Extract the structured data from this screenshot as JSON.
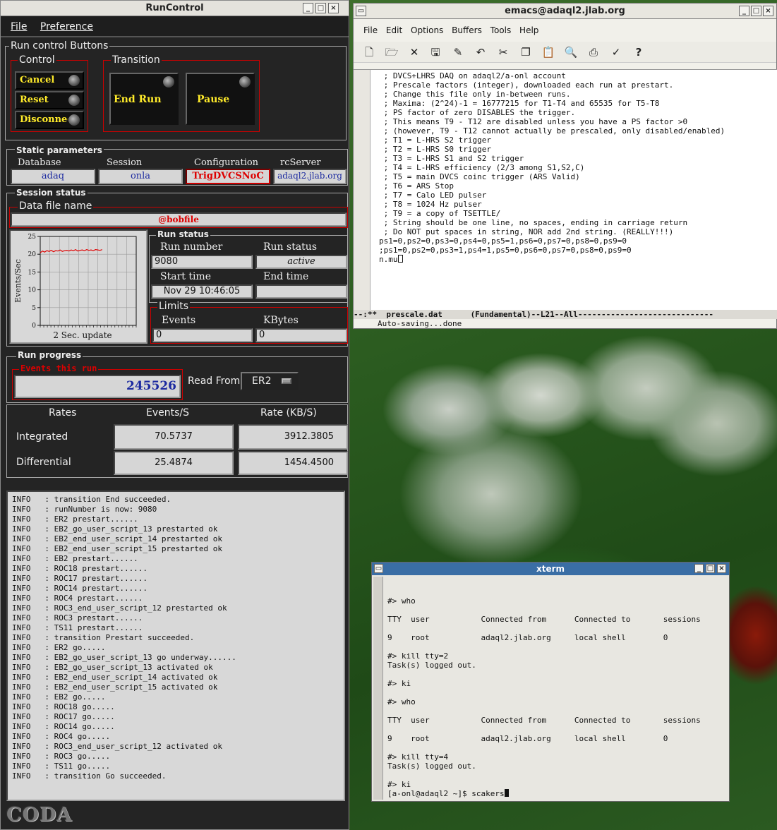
{
  "runcontrol": {
    "title": "RunControl",
    "menu": [
      "File",
      "Preference"
    ],
    "buttons_group": "Run control Buttons",
    "control_label": "Control",
    "control_buttons": [
      "Cancel",
      "Reset",
      "Disconnect"
    ],
    "transition_label": "Transition",
    "transition_buttons": [
      "End Run",
      "Pause"
    ],
    "static_label": "Static parameters",
    "static": {
      "database_label": "Database",
      "database": "adaq",
      "session_label": "Session",
      "session": "onla",
      "config_label": "Configuration",
      "config": "TrigDVCSNoC",
      "server_label": "rcServer",
      "server": "adaql2.jlab.org"
    },
    "session_status": "Session status",
    "datafile_label": "Data file name",
    "datafile": "@bobfile",
    "chart": {
      "ylabel": "Events/Sec",
      "footer": "2 Sec. update"
    },
    "run_status_group": "Run status",
    "run_number_label": "Run number",
    "run_number": "9080",
    "run_status_label": "Run status",
    "run_status": "active",
    "start_time_label": "Start time",
    "start_time": "Nov 29 10:46:05",
    "end_time_label": "End time",
    "end_time": "",
    "limits_label": "Limits",
    "events_label": "Events",
    "events": "0",
    "kbytes_label": "KBytes",
    "kbytes": "0",
    "run_progress_label": "Run progress",
    "events_this_run_label": "Events this run",
    "events_this_run": "245526",
    "read_from_label": "Read From:",
    "read_from": "ER2",
    "rates": {
      "header": [
        "Rates",
        "Events/S",
        "Rate (KB/S)"
      ],
      "integrated_label": "Integrated",
      "integrated_events": "70.5737",
      "integrated_rate": "3912.3805",
      "differential_label": "Differential",
      "differential_events": "25.4874",
      "differential_rate": "1454.4500"
    },
    "log": [
      "INFO   : transition End succeeded.",
      "INFO   : runNumber is now: 9080",
      "INFO   : ER2 prestart......",
      "INFO   : EB2_go_user_script_13 prestarted ok",
      "INFO   : EB2_end_user_script_14 prestarted ok",
      "INFO   : EB2_end_user_script_15 prestarted ok",
      "INFO   : EB2 prestart......",
      "INFO   : ROC18 prestart......",
      "INFO   : ROC17 prestart......",
      "INFO   : ROC14 prestart......",
      "INFO   : ROC4 prestart......",
      "INFO   : ROC3_end_user_script_12 prestarted ok",
      "INFO   : ROC3 prestart......",
      "INFO   : TS11 prestart......",
      "INFO   : transition Prestart succeeded.",
      "INFO   : ER2 go.....",
      "INFO   : EB2_go_user_script_13 go underway......",
      "INFO   : EB2_go_user_script_13 activated ok",
      "INFO   : EB2_end_user_script_14 activated ok",
      "INFO   : EB2_end_user_script_15 activated ok",
      "INFO   : EB2 go.....",
      "INFO   : ROC18 go.....",
      "INFO   : ROC17 go.....",
      "INFO   : ROC14 go.....",
      "INFO   : ROC4 go.....",
      "INFO   : ROC3_end_user_script_12 activated ok",
      "INFO   : ROC3 go.....",
      "INFO   : TS11 go.....",
      "INFO   : transition Go succeeded."
    ],
    "logo": "CODA"
  },
  "chart_data": {
    "type": "line",
    "xlabel": "2 Sec. update",
    "ylabel": "Events/Sec",
    "ylim": [
      0,
      25
    ],
    "yticks": [
      0,
      5,
      10,
      15,
      20,
      25
    ],
    "x": [
      0,
      1,
      2,
      3,
      4,
      5,
      6,
      7,
      8,
      9,
      10,
      11,
      12,
      13,
      14,
      15,
      16,
      17,
      18,
      19,
      20,
      21,
      22,
      23,
      24,
      25,
      26,
      27,
      28
    ],
    "series": [
      {
        "values": [
          20.4,
          20.9,
          20.6,
          21.0,
          20.8,
          21.1,
          20.7,
          21.0,
          20.9,
          21.2,
          20.8,
          21.0,
          21.1,
          20.9,
          21.2,
          21.0,
          21.3,
          20.9,
          21.1,
          21.2,
          21.0,
          21.3,
          21.1,
          21.2,
          21.0,
          21.3,
          21.2,
          21.1,
          21.3
        ],
        "color": "#e00000"
      }
    ]
  },
  "emacs": {
    "title": "emacs@adaql2.jlab.org",
    "menu": [
      "File",
      "Edit",
      "Options",
      "Buffers",
      "Tools",
      "Help"
    ],
    "lines": [
      " ; DVCS+LHRS DAQ on adaql2/a-onl account",
      " ; Prescale factors (integer), downloaded each run at prestart.",
      " ; Change this file only in-between runs.",
      " ; Maxima: (2^24)-1 = 16777215 for T1-T4 and 65535 for T5-T8",
      " ; PS factor of zero DISABLES the trigger.",
      " ; This means T9 - T12 are disabled unless you have a PS factor >0",
      " ; (however, T9 - T12 cannot actually be prescaled, only disabled/enabled)",
      " ; T1 = L-HRS S2 trigger",
      " ; T2 = L-HRS S0 trigger",
      " ; T3 = L-HRS S1 and S2 trigger",
      " ; T4 = L-HRS efficiency (2/3 among S1,S2,C)",
      " ; T5 = main DVCS coinc trigger (ARS Valid)",
      " ; T6 = ARS Stop",
      " ; T7 = Calo LED pulser",
      " ; T8 = 1024 Hz pulser",
      " ; T9 = a copy of TSETTLE/",
      " ; String should be one line, no spaces, ending in carriage return",
      " ; Do NOT put spaces in string, NOR add 2nd string. (REALLY!!!)",
      "ps1=0,ps2=0,ps3=0,ps4=0,ps5=1,ps6=0,ps7=0,ps8=0,ps9=0",
      ";ps1=0,ps2=0,ps3=1,ps4=1,ps5=0,ps6=0,ps7=0,ps8=0,ps9=0",
      "n.mu"
    ],
    "modeline": "--:**  prescale.dat      (Fundamental)--L21--All-----------------------------",
    "echo": "Auto-saving...done"
  },
  "xterm": {
    "title": "xterm",
    "lines": [
      "",
      "",
      "#> who",
      "",
      "TTY  user           Connected from      Connected to       sessions",
      "",
      "9    root           adaql2.jlab.org     local shell        0",
      "",
      "#> kill tty=2",
      "Task(s) logged out.",
      "",
      "#> ki",
      "",
      "#> who",
      "",
      "TTY  user           Connected from      Connected to       sessions",
      "",
      "9    root           adaql2.jlab.org     local shell        0",
      "",
      "#> kill tty=4",
      "Task(s) logged out.",
      "",
      "#> ki",
      "[a-onl@adaql2 ~]$ scakers"
    ]
  }
}
